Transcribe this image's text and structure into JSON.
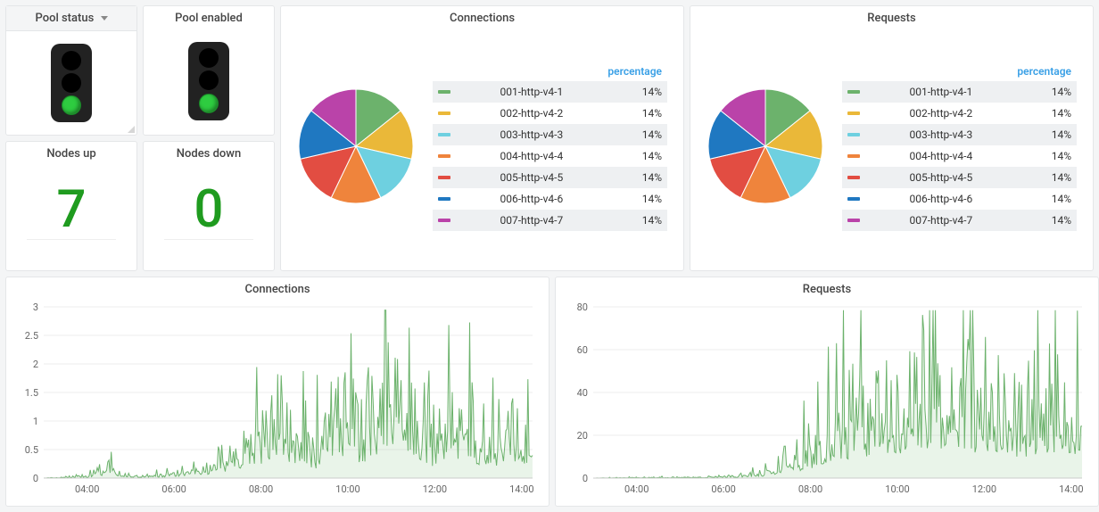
{
  "panels": {
    "pool_status": {
      "title": "Pool status"
    },
    "pool_enabled": {
      "title": "Pool enabled"
    },
    "nodes_up": {
      "title": "Nodes up",
      "value": "7"
    },
    "nodes_down": {
      "title": "Nodes down",
      "value": "0"
    },
    "connections_pie": {
      "title": "Connections"
    },
    "requests_pie": {
      "title": "Requests"
    },
    "connections_ts": {
      "title": "Connections"
    },
    "requests_ts": {
      "title": "Requests"
    }
  },
  "legend": {
    "header_percentage": "percentage",
    "items": [
      {
        "label": "001-http-v4-1",
        "perc": "14%",
        "color": "#6cb26c"
      },
      {
        "label": "002-http-v4-2",
        "perc": "14%",
        "color": "#eab839"
      },
      {
        "label": "003-http-v4-3",
        "perc": "14%",
        "color": "#6ed0e0"
      },
      {
        "label": "004-http-v4-4",
        "perc": "14%",
        "color": "#ef843c"
      },
      {
        "label": "005-http-v4-5",
        "perc": "14%",
        "color": "#e24d42"
      },
      {
        "label": "006-http-v4-6",
        "perc": "14%",
        "color": "#1f78c1"
      },
      {
        "label": "007-http-v4-7",
        "perc": "14%",
        "color": "#ba43a9"
      }
    ]
  },
  "chart_data": [
    {
      "id": "connections_pie",
      "type": "pie",
      "title": "Connections",
      "series": [
        {
          "name": "001-http-v4-1",
          "value": 14
        },
        {
          "name": "002-http-v4-2",
          "value": 14
        },
        {
          "name": "003-http-v4-3",
          "value": 14
        },
        {
          "name": "004-http-v4-4",
          "value": 14
        },
        {
          "name": "005-http-v4-5",
          "value": 14
        },
        {
          "name": "006-http-v4-6",
          "value": 14
        },
        {
          "name": "007-http-v4-7",
          "value": 14
        }
      ]
    },
    {
      "id": "requests_pie",
      "type": "pie",
      "title": "Requests",
      "series": [
        {
          "name": "001-http-v4-1",
          "value": 14
        },
        {
          "name": "002-http-v4-2",
          "value": 14
        },
        {
          "name": "003-http-v4-3",
          "value": 14
        },
        {
          "name": "004-http-v4-4",
          "value": 14
        },
        {
          "name": "005-http-v4-5",
          "value": 14
        },
        {
          "name": "006-http-v4-6",
          "value": 14
        },
        {
          "name": "007-http-v4-7",
          "value": 14
        }
      ]
    },
    {
      "id": "connections_ts",
      "type": "area",
      "title": "Connections",
      "xlabel": "",
      "ylabel": "",
      "ylim": [
        0,
        3.0
      ],
      "x_ticks": [
        "04:00",
        "06:00",
        "08:00",
        "10:00",
        "12:00",
        "14:00"
      ],
      "y_ticks": [
        0,
        0.5,
        1.0,
        1.5,
        2.0,
        2.5,
        3.0
      ],
      "series": [
        {
          "name": "connections",
          "color": "#6cb26c",
          "x": [
            "03:00",
            "04:00",
            "04:30",
            "05:00",
            "06:00",
            "06:30",
            "07:00",
            "07:20",
            "07:40",
            "08:00",
            "08:20",
            "08:40",
            "09:00",
            "09:15",
            "09:30",
            "09:45",
            "10:00",
            "10:15",
            "10:30",
            "10:45",
            "11:00",
            "11:15",
            "11:30",
            "11:45",
            "12:00",
            "12:20",
            "12:40",
            "13:00",
            "13:20",
            "13:40",
            "14:00",
            "14:15"
          ],
          "y": [
            0,
            0.05,
            0.3,
            0.05,
            0.1,
            0.3,
            0.3,
            0.6,
            1.0,
            1.2,
            1.7,
            1.3,
            1.2,
            0.8,
            1.4,
            2.2,
            1.5,
            1.1,
            1.6,
            2.0,
            2.3,
            2.6,
            1.8,
            1.3,
            1.0,
            1.4,
            1.8,
            1.2,
            0.9,
            1.6,
            1.0,
            1.7
          ]
        }
      ]
    },
    {
      "id": "requests_ts",
      "type": "area",
      "title": "Requests",
      "xlabel": "",
      "ylabel": "",
      "ylim": [
        0,
        80
      ],
      "x_ticks": [
        "04:00",
        "06:00",
        "08:00",
        "10:00",
        "12:00",
        "14:00"
      ],
      "y_ticks": [
        0,
        20,
        40,
        60,
        80
      ],
      "series": [
        {
          "name": "requests",
          "color": "#6cb26c",
          "x": [
            "03:00",
            "04:00",
            "05:00",
            "06:00",
            "06:30",
            "07:00",
            "07:20",
            "07:40",
            "08:00",
            "08:20",
            "08:40",
            "09:00",
            "09:20",
            "09:40",
            "10:00",
            "10:20",
            "10:40",
            "11:00",
            "11:20",
            "11:40",
            "12:00",
            "12:20",
            "12:40",
            "13:00",
            "13:20",
            "13:40",
            "14:00",
            "14:15"
          ],
          "y": [
            0,
            0.5,
            0.5,
            1,
            2,
            5,
            10,
            15,
            22,
            35,
            40,
            45,
            50,
            58,
            55,
            62,
            70,
            65,
            58,
            60,
            55,
            52,
            50,
            48,
            42,
            52,
            60,
            50
          ]
        }
      ]
    }
  ]
}
